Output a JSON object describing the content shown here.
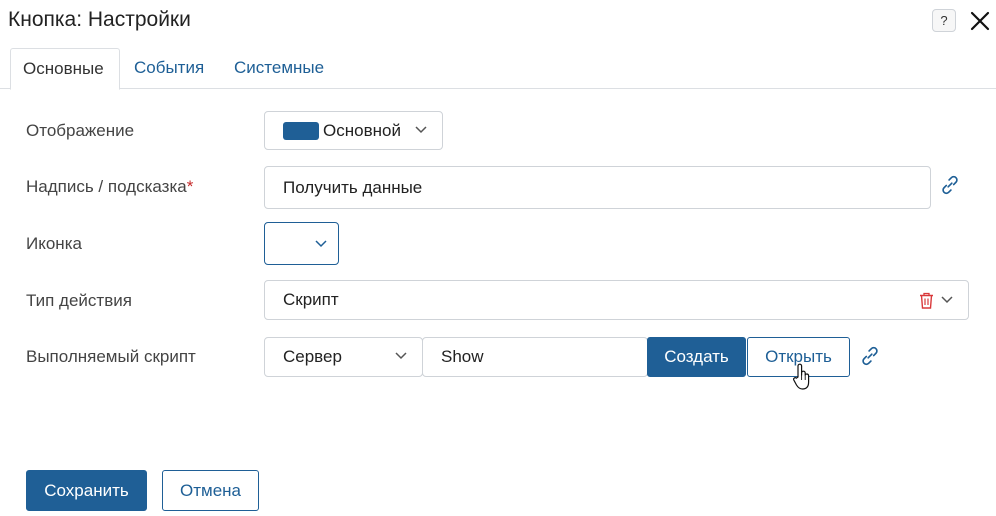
{
  "dialog": {
    "title": "Кнопка: Настройки",
    "help_label": "?"
  },
  "tabs": [
    {
      "label": "Основные",
      "active": true
    },
    {
      "label": "События",
      "active": false
    },
    {
      "label": "Системные",
      "active": false
    }
  ],
  "form": {
    "display": {
      "label": "Отображение",
      "value": "Основной",
      "swatch_color": "#1f5f96"
    },
    "caption": {
      "label": "Надпись / подсказка",
      "required_mark": "*",
      "value": "Получить данные"
    },
    "icon": {
      "label": "Иконка",
      "value": ""
    },
    "action_type": {
      "label": "Тип действия",
      "value": "Скрипт"
    },
    "script": {
      "label": "Выполняемый скрипт",
      "location": "Сервер",
      "name": "Show",
      "create_label": "Создать",
      "open_label": "Открыть"
    }
  },
  "footer": {
    "save_label": "Сохранить",
    "cancel_label": "Отмена"
  },
  "colors": {
    "accent": "#1f5f96",
    "link": "#1e5f96",
    "danger": "#d9383a"
  }
}
